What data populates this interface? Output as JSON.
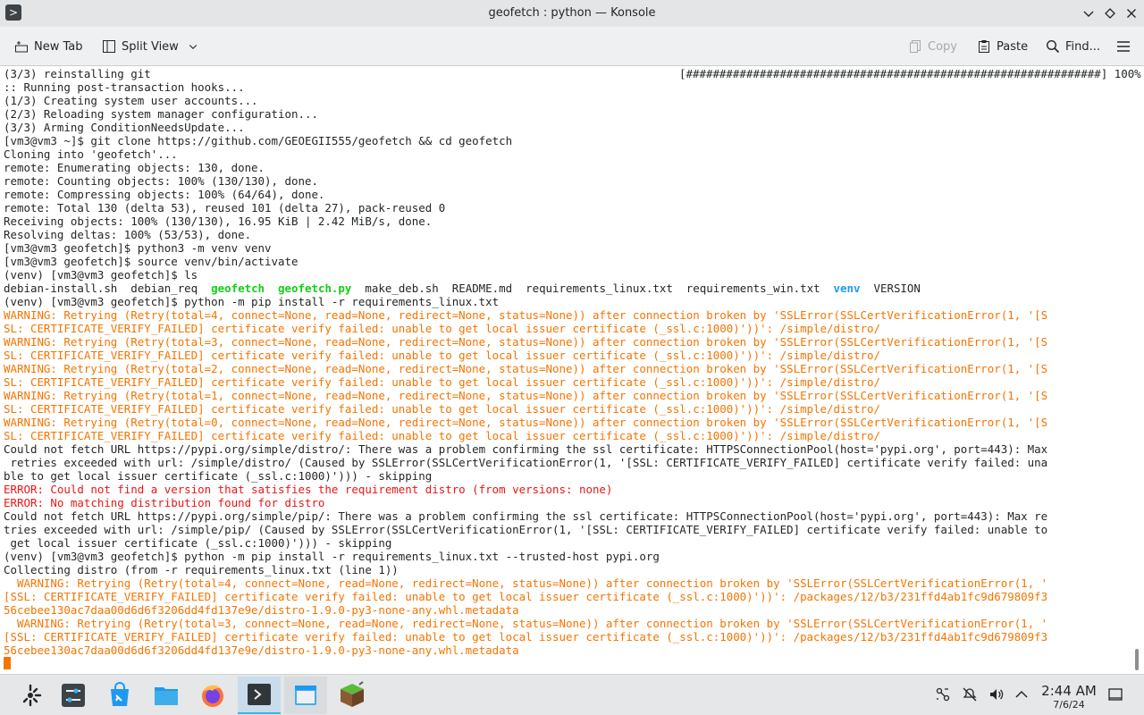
{
  "window": {
    "title": "geofetch : python — Konsole"
  },
  "toolbar": {
    "new_tab": "New Tab",
    "split_view": "Split View",
    "copy": "Copy",
    "paste": "Paste",
    "find": "Find..."
  },
  "terminal": {
    "progress_text": "[##############################################################] 100%",
    "lines": [
      [
        {
          "t": "(3/3) reinstalling git"
        }
      ],
      [
        {
          "t": ":: Running post-transaction hooks..."
        }
      ],
      [
        {
          "t": "(1/3) Creating system user accounts..."
        }
      ],
      [
        {
          "t": "(2/3) Reloading system manager configuration..."
        }
      ],
      [
        {
          "t": "(3/3) Arming ConditionNeedsUpdate..."
        }
      ],
      [
        {
          "t": "[vm3@vm3 ~]$ git clone https://github.com/GEOEGII555/geofetch && cd geofetch"
        }
      ],
      [
        {
          "t": "Cloning into 'geofetch'..."
        }
      ],
      [
        {
          "t": "remote: Enumerating objects: 130, done."
        }
      ],
      [
        {
          "t": "remote: Counting objects: 100% (130/130), done."
        }
      ],
      [
        {
          "t": "remote: Compressing objects: 100% (64/64), done."
        }
      ],
      [
        {
          "t": "remote: Total 130 (delta 53), reused 101 (delta 27), pack-reused 0"
        }
      ],
      [
        {
          "t": "Receiving objects: 100% (130/130), 16.95 KiB | 2.42 MiB/s, done."
        }
      ],
      [
        {
          "t": "Resolving deltas: 100% (53/53), done."
        }
      ],
      [
        {
          "t": "[vm3@vm3 geofetch]$ python3 -m venv venv"
        }
      ],
      [
        {
          "t": "[vm3@vm3 geofetch]$ source venv/bin/activate"
        }
      ],
      [
        {
          "t": "(venv) [vm3@vm3 geofetch]$ ls"
        }
      ],
      [
        {
          "t": "debian-install.sh  debian_req  "
        },
        {
          "t": "geofetch",
          "c": "c-green"
        },
        {
          "t": "  "
        },
        {
          "t": "geofetch.py",
          "c": "c-green2"
        },
        {
          "t": "  make_deb.sh  README.md  requirements_linux.txt  requirements_win.txt  "
        },
        {
          "t": "venv",
          "c": "c-blue"
        },
        {
          "t": "  VERSION"
        }
      ],
      [
        {
          "t": "(venv) [vm3@vm3 geofetch]$ python -m pip install -r requirements_linux.txt"
        }
      ],
      [
        {
          "t": "WARNING: Retrying (Retry(total=4, connect=None, read=None, redirect=None, status=None)) after connection broken by 'SSLError(SSLCertVerificationError(1, '[S",
          "c": "c-warn"
        }
      ],
      [
        {
          "t": "SL: CERTIFICATE_VERIFY_FAILED] certificate verify failed: unable to get local issuer certificate (_ssl.c:1000)'))': /simple/distro/",
          "c": "c-warn"
        }
      ],
      [
        {
          "t": "WARNING: Retrying (Retry(total=3, connect=None, read=None, redirect=None, status=None)) after connection broken by 'SSLError(SSLCertVerificationError(1, '[S",
          "c": "c-warn"
        }
      ],
      [
        {
          "t": "SL: CERTIFICATE_VERIFY_FAILED] certificate verify failed: unable to get local issuer certificate (_ssl.c:1000)'))': /simple/distro/",
          "c": "c-warn"
        }
      ],
      [
        {
          "t": "WARNING: Retrying (Retry(total=2, connect=None, read=None, redirect=None, status=None)) after connection broken by 'SSLError(SSLCertVerificationError(1, '[S",
          "c": "c-warn"
        }
      ],
      [
        {
          "t": "SL: CERTIFICATE_VERIFY_FAILED] certificate verify failed: unable to get local issuer certificate (_ssl.c:1000)'))': /simple/distro/",
          "c": "c-warn"
        }
      ],
      [
        {
          "t": "WARNING: Retrying (Retry(total=1, connect=None, read=None, redirect=None, status=None)) after connection broken by 'SSLError(SSLCertVerificationError(1, '[S",
          "c": "c-warn"
        }
      ],
      [
        {
          "t": "SL: CERTIFICATE_VERIFY_FAILED] certificate verify failed: unable to get local issuer certificate (_ssl.c:1000)'))': /simple/distro/",
          "c": "c-warn"
        }
      ],
      [
        {
          "t": "WARNING: Retrying (Retry(total=0, connect=None, read=None, redirect=None, status=None)) after connection broken by 'SSLError(SSLCertVerificationError(1, '[S",
          "c": "c-warn"
        }
      ],
      [
        {
          "t": "SL: CERTIFICATE_VERIFY_FAILED] certificate verify failed: unable to get local issuer certificate (_ssl.c:1000)'))': /simple/distro/",
          "c": "c-warn"
        }
      ],
      [
        {
          "t": "Could not fetch URL https://pypi.org/simple/distro/: There was a problem confirming the ssl certificate: HTTPSConnectionPool(host='pypi.org', port=443): Max"
        }
      ],
      [
        {
          "t": " retries exceeded with url: /simple/distro/ (Caused by SSLError(SSLCertVerificationError(1, '[SSL: CERTIFICATE_VERIFY_FAILED] certificate verify failed: una"
        }
      ],
      [
        {
          "t": "ble to get local issuer certificate (_ssl.c:1000)'))) - skipping"
        }
      ],
      [
        {
          "t": "ERROR: Could not find a version that satisfies the requirement distro (from versions: none)",
          "c": "c-err"
        }
      ],
      [
        {
          "t": "ERROR: No matching distribution found for distro",
          "c": "c-err"
        }
      ],
      [
        {
          "t": "Could not fetch URL https://pypi.org/simple/pip/: There was a problem confirming the ssl certificate: HTTPSConnectionPool(host='pypi.org', port=443): Max re"
        }
      ],
      [
        {
          "t": "tries exceeded with url: /simple/pip/ (Caused by SSLError(SSLCertVerificationError(1, '[SSL: CERTIFICATE_VERIFY_FAILED] certificate verify failed: unable to"
        }
      ],
      [
        {
          "t": " get local issuer certificate (_ssl.c:1000)'))) - skipping"
        }
      ],
      [
        {
          "t": "(venv) [vm3@vm3 geofetch]$ python -m pip install -r requirements_linux.txt --trusted-host pypi.org"
        }
      ],
      [
        {
          "t": "Collecting distro (from -r requirements_linux.txt (line 1))"
        }
      ],
      [
        {
          "t": "  WARNING: Retrying (Retry(total=4, connect=None, read=None, redirect=None, status=None)) after connection broken by 'SSLError(SSLCertVerificationError(1, '",
          "c": "c-warn"
        }
      ],
      [
        {
          "t": "[SSL: CERTIFICATE_VERIFY_FAILED] certificate verify failed: unable to get local issuer certificate (_ssl.c:1000)'))': /packages/12/b3/231ffd4ab1fc9d679809f3",
          "c": "c-warn"
        }
      ],
      [
        {
          "t": "56cebee130ac7daa00d6d6f3206dd4fd137e9e/distro-1.9.0-py3-none-any.whl.metadata",
          "c": "c-warn"
        }
      ],
      [
        {
          "t": "  WARNING: Retrying (Retry(total=3, connect=None, read=None, redirect=None, status=None)) after connection broken by 'SSLError(SSLCertVerificationError(1, '",
          "c": "c-warn"
        }
      ],
      [
        {
          "t": "[SSL: CERTIFICATE_VERIFY_FAILED] certificate verify failed: unable to get local issuer certificate (_ssl.c:1000)'))': /packages/12/b3/231ffd4ab1fc9d679809f3",
          "c": "c-warn"
        }
      ],
      [
        {
          "t": "56cebee130ac7daa00d6d6f3206dd4fd137e9e/distro-1.9.0-py3-none-any.whl.metadata",
          "c": "c-warn"
        }
      ]
    ]
  },
  "taskbar": {
    "clock_time": "2:44 AM",
    "clock_date": "7/6/24"
  }
}
